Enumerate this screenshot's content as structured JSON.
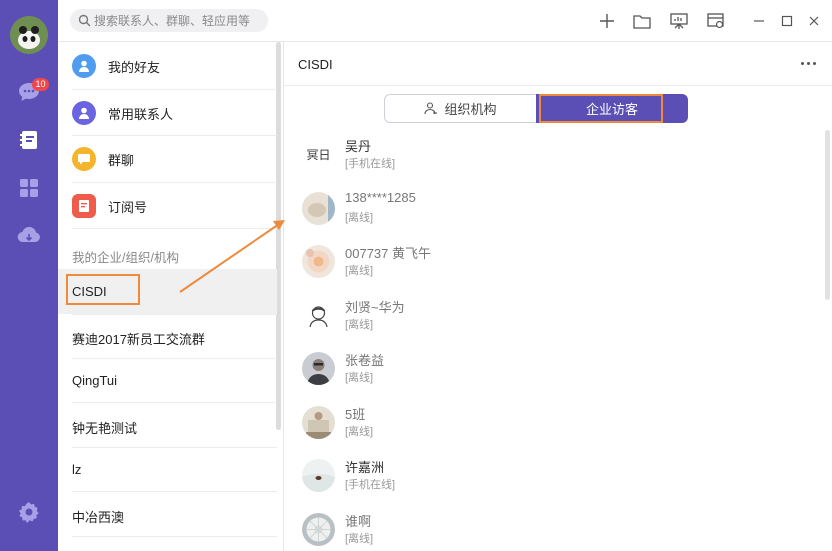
{
  "rail": {
    "badge_count": "10",
    "icons": [
      "chat-icon",
      "contacts-icon",
      "apps-icon",
      "cloud-icon",
      "settings-icon"
    ]
  },
  "topbar": {
    "search_placeholder": "搜索联系人、群聊、轻应用等",
    "icons": [
      "add-icon",
      "folder-icon",
      "presentation-icon",
      "calendar-settings-icon",
      "minimize-icon",
      "maximize-icon",
      "close-icon"
    ]
  },
  "list": {
    "categories": [
      {
        "label": "我的好友",
        "icon": "friend-icon",
        "color": "#4f9cf0"
      },
      {
        "label": "常用联系人",
        "icon": "contact-icon",
        "color": "#6a64e0"
      },
      {
        "label": "群聊",
        "icon": "group-chat-icon",
        "color": "#f5b52a"
      },
      {
        "label": "订阅号",
        "icon": "subscription-icon",
        "color": "#f05c4b"
      }
    ],
    "section_title": "我的企业/组织/机构",
    "orgs": [
      {
        "label": "CISDI"
      },
      {
        "label": "赛迪2017新员工交流群"
      },
      {
        "label": "QingTui"
      },
      {
        "label": "钟无艳测试"
      },
      {
        "label": "lz"
      },
      {
        "label": "中冶西澳"
      }
    ]
  },
  "main": {
    "title": "CISDI",
    "tabs": [
      {
        "label": "组织机构",
        "icon": "org-chart-icon"
      },
      {
        "label": "企业访客"
      }
    ],
    "contacts": [
      {
        "name": "吴丹",
        "status": "[手机在线]"
      },
      {
        "name": "138****1285",
        "status": "[离线]"
      },
      {
        "name": "007737 黄飞午",
        "status": "[离线]"
      },
      {
        "name": "刘贤~华为",
        "status": "[离线]"
      },
      {
        "name": "张卷益",
        "status": "[离线]"
      },
      {
        "name": "5班",
        "status": "[离线]"
      },
      {
        "name": "许嘉洲",
        "status": "[手机在线]"
      },
      {
        "name": "谁啊",
        "status": "[离线]"
      }
    ]
  },
  "colors": {
    "brand": "#5b4fb6",
    "highlight": "#ee8a3c"
  }
}
